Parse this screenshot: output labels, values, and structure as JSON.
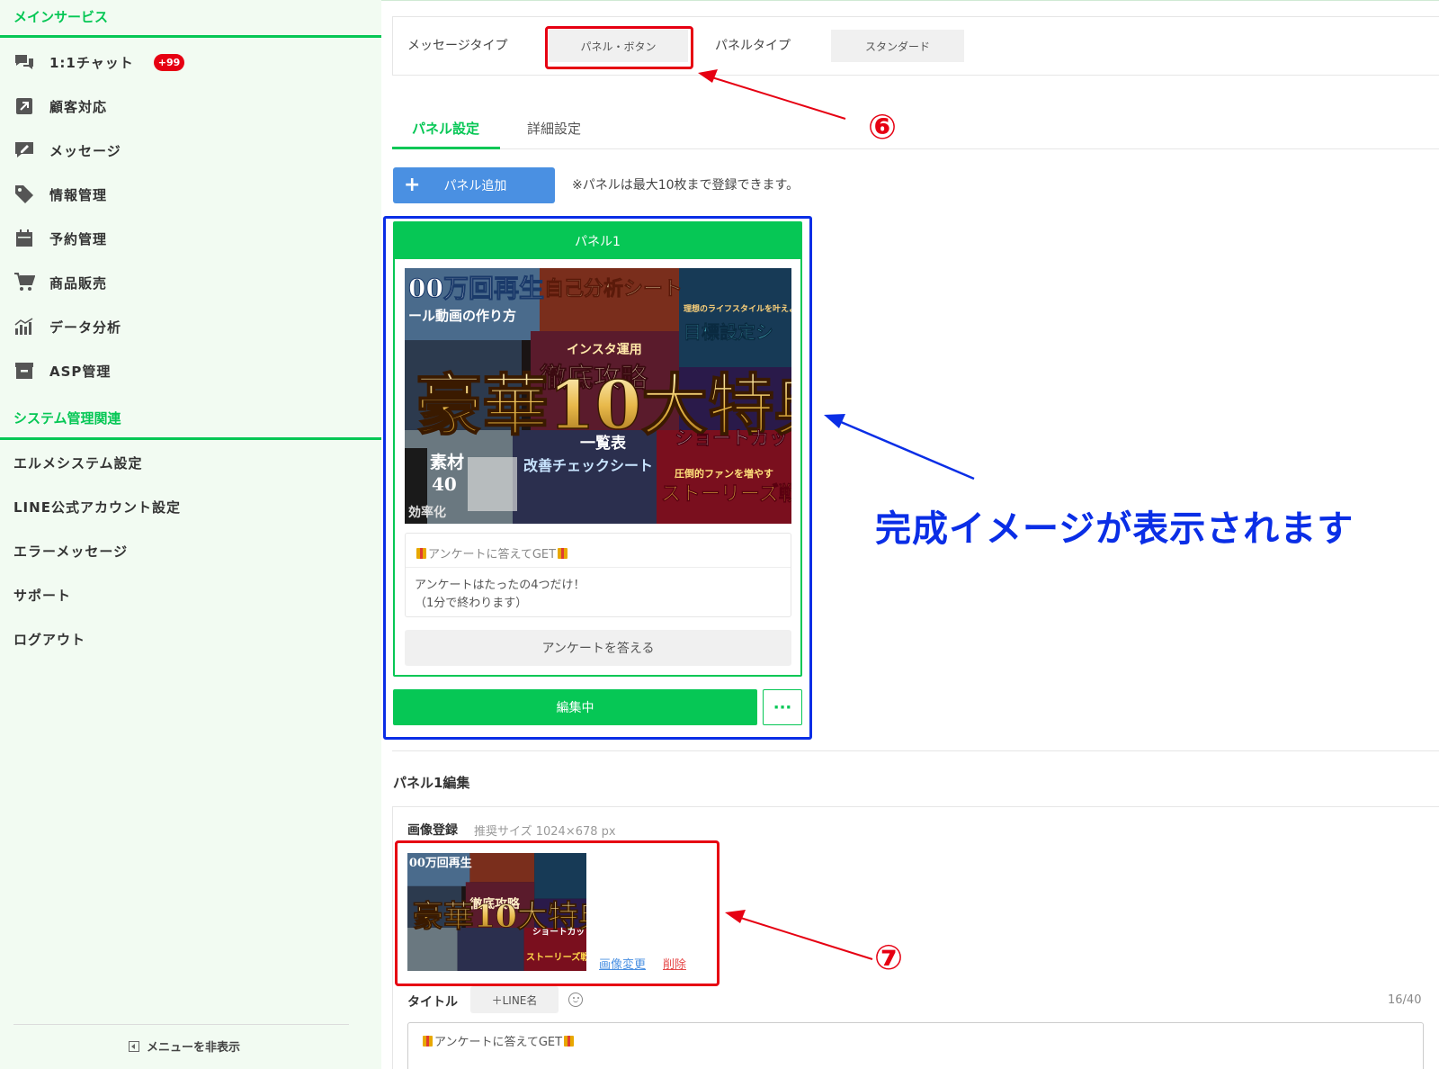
{
  "sidebar": {
    "section_main": "メインサービス",
    "section_system": "システム管理関連",
    "items": [
      {
        "label": "1:1チャット",
        "icon": "chat-icon",
        "badge": "+99"
      },
      {
        "label": "顧客対応",
        "icon": "external-link-icon"
      },
      {
        "label": "メッセージ",
        "icon": "message-edit-icon"
      },
      {
        "label": "情報管理",
        "icon": "tag-icon"
      },
      {
        "label": "予約管理",
        "icon": "calendar-icon"
      },
      {
        "label": "商品販売",
        "icon": "cart-icon"
      },
      {
        "label": "データ分析",
        "icon": "bar-chart-icon"
      },
      {
        "label": "ASP管理",
        "icon": "box-icon"
      }
    ],
    "system_items": [
      {
        "label": "エルメシステム設定"
      },
      {
        "label": "LINE公式アカウント設定"
      },
      {
        "label": "エラーメッセージ"
      },
      {
        "label": "サポート"
      },
      {
        "label": "ログアウト"
      }
    ],
    "hide_menu": "メニューを非表示"
  },
  "message_type": {
    "label": "メッセージタイプ",
    "value": "パネル・ボタン",
    "panel_type_label": "パネルタイプ",
    "panel_type_value": "スタンダード"
  },
  "tabs": [
    {
      "label": "パネル設定",
      "active": true
    },
    {
      "label": "詳細設定",
      "active": false
    }
  ],
  "add_panel": {
    "label": "パネル追加",
    "note": "※パネルは最大10枚まで登録できます。"
  },
  "panel": {
    "header": "パネル1",
    "image_main_text": "豪華10大特典",
    "image_texts": [
      "00万回再生",
      "ール動画の作り方",
      "自己分析シート",
      "徹底攻略",
      "インスタ運用",
      "目標設定シ",
      "理想のライフスタイルを叶えよ",
      "ショートカットキ",
      "一覧表",
      "改善チェックシート",
      "圧倒的ファンを増やす",
      "ストーリーズ戦",
      "素材",
      "40",
      "効率化"
    ],
    "text_title": "アンケートに答えてGET",
    "text_body_line1": "アンケートはたったの4つだけ！",
    "text_body_line2": "（1分で終わります）",
    "action_label": "アンケートを答える",
    "editing_label": "編集中",
    "more_label": "···"
  },
  "edit": {
    "title": "パネル1編集",
    "image_label": "画像登録",
    "image_size_hint": "推奨サイズ 1024×678 px",
    "change_image": "画像変更",
    "delete": "削除",
    "title_label": "タイトル",
    "line_name_btn": "＋LINE名",
    "counter": "16/40",
    "title_value": "アンケートに答えてGET"
  },
  "annotations": {
    "six": "⑥",
    "seven": "⑦",
    "main": "完成イメージが表示されます"
  },
  "colors": {
    "brand_green": "#06c755",
    "annotation_red": "#e60012",
    "annotation_blue": "#0a2ee6",
    "button_blue": "#4a90e2"
  }
}
